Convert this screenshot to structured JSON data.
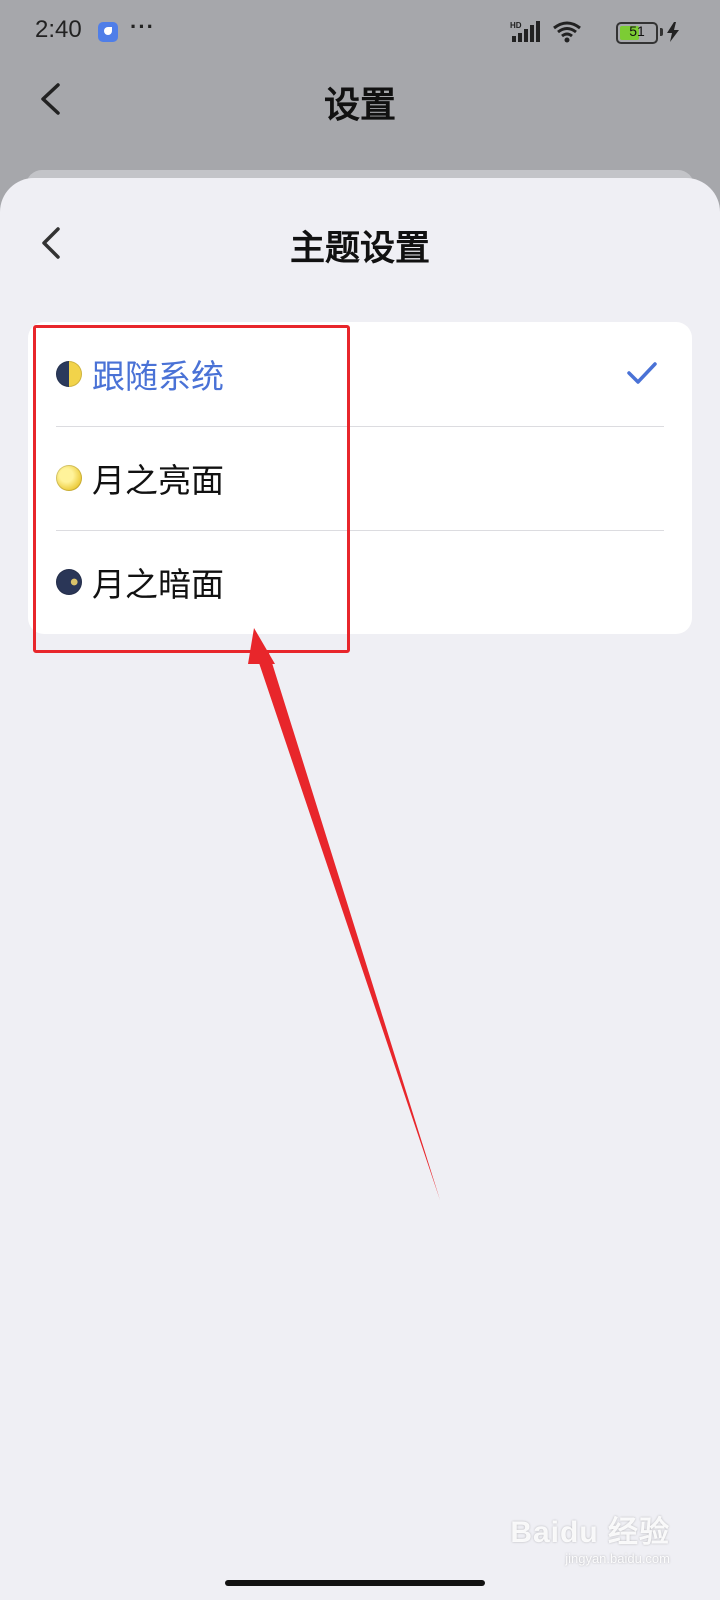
{
  "status_bar": {
    "time": "2:40",
    "dots": "···",
    "battery": "51",
    "icons": [
      "app-notification-icon",
      "signal-icon",
      "wifi-icon",
      "battery-icon",
      "charging-icon"
    ]
  },
  "background_page": {
    "title": "设置",
    "back_icon": "chevron-left-icon"
  },
  "sheet": {
    "title": "主题设置",
    "back_icon": "chevron-left-icon",
    "options": [
      {
        "label": "跟随系统",
        "icon": "moon-half-icon",
        "selected": true
      },
      {
        "label": "月之亮面",
        "icon": "moon-full-icon",
        "selected": false
      },
      {
        "label": "月之暗面",
        "icon": "moon-dark-icon",
        "selected": false
      }
    ],
    "selected_color": "#4a72d6"
  },
  "annotation": {
    "color": "#e8262b"
  },
  "watermark": {
    "main": "Baidu 经验",
    "sub": "jingyan.baidu.com"
  }
}
